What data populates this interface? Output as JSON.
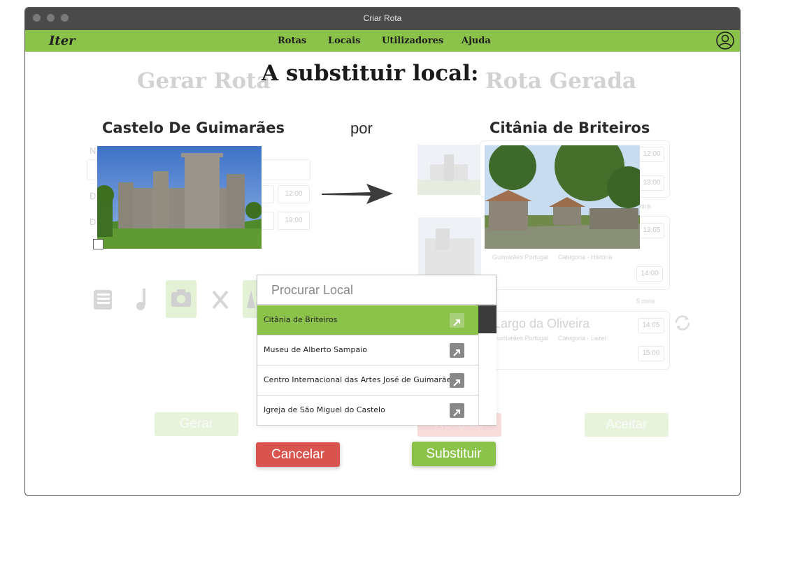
{
  "window": {
    "title": "Criar Rota"
  },
  "navbar": {
    "logo": "Iter",
    "items": [
      "Rotas",
      "Locais",
      "Utilizadores",
      "Ajuda"
    ],
    "brand_color": "#8bc34a"
  },
  "background": {
    "left_heading": "Gerar Rota",
    "right_heading": "Rota Gerada",
    "times_left": [
      "12:00",
      "19:00"
    ],
    "times_right": [
      "12:00",
      "13:00",
      "13:05",
      "14:00",
      "14:05",
      "15:00"
    ],
    "route_item": {
      "name": "Largo da Oliveira",
      "location": "Guimarães Portugal",
      "category": "Categoria - Lazer"
    },
    "route_item_prev": {
      "location": "Guimarães Portugal",
      "category": "Categoria - História"
    },
    "gaps": [
      "mins",
      "5 mins"
    ],
    "buttons": {
      "generate": "Gerar",
      "refuse": "Recusar",
      "accept": "Aceitar"
    }
  },
  "dialog": {
    "heading": "A substituir local:",
    "from_place": "Castelo De Guimarães",
    "connector": "por",
    "to_place": "Citânia de Briteiros",
    "search_placeholder": "Procurar Local",
    "results": [
      "Citânia de Briteiros",
      "Museu de Alberto Sampaio",
      "Centro Internacional das Artes José de Guimarães",
      "Igreja de São Miguel do Castelo"
    ],
    "selected_index": 0,
    "cancel_label": "Cancelar",
    "replace_label": "Substituir",
    "cancel_color": "#d9534f",
    "replace_color": "#8bc34a"
  }
}
